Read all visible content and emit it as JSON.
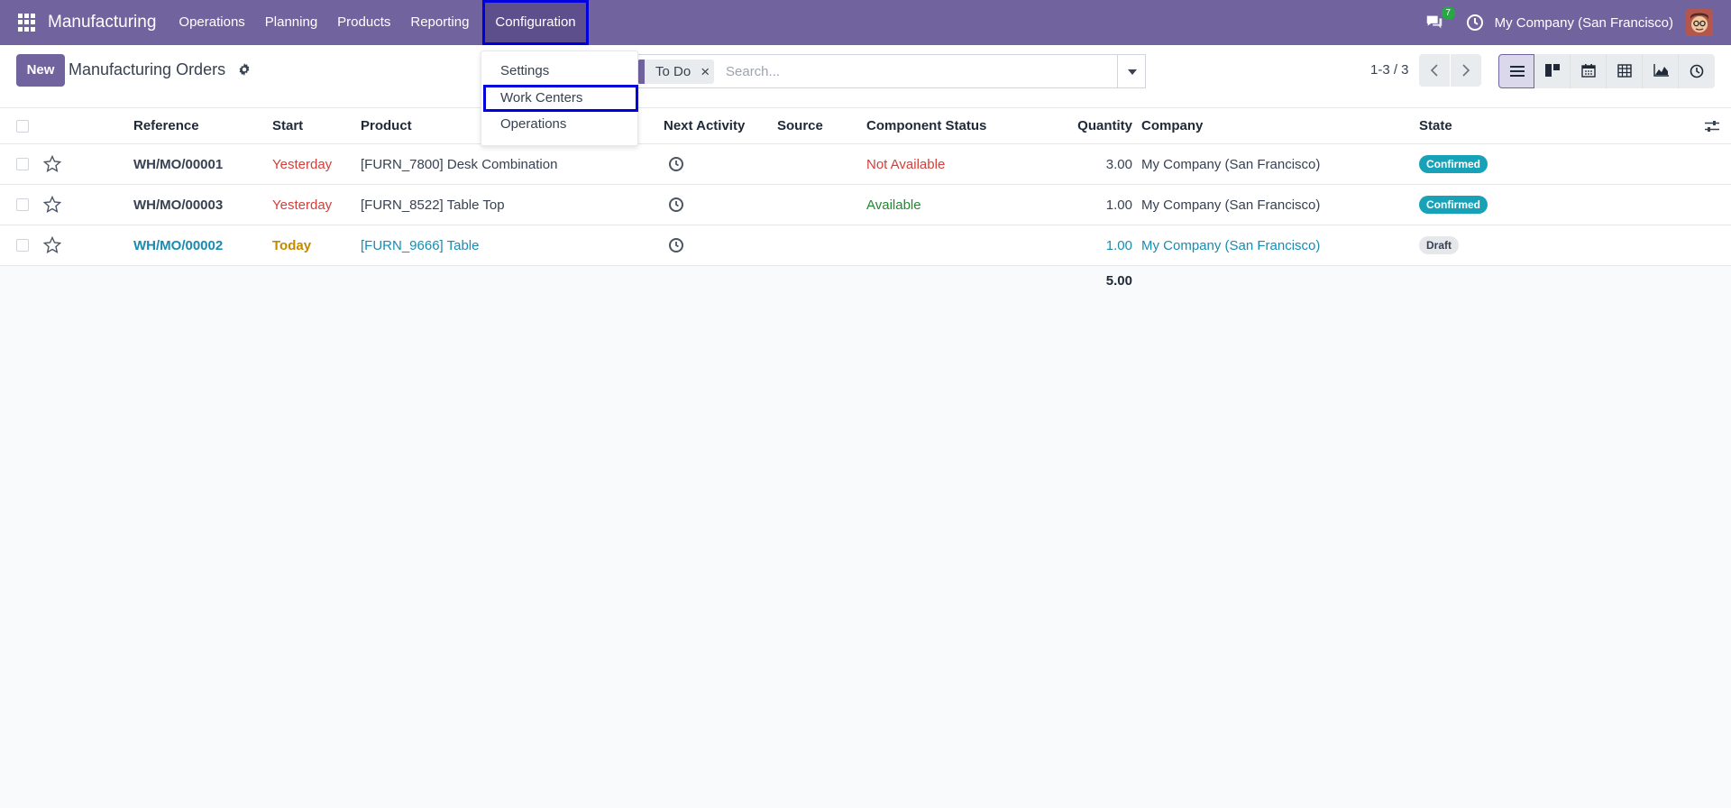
{
  "navbar": {
    "brand": "Manufacturing",
    "menu": [
      "Operations",
      "Planning",
      "Products",
      "Reporting",
      "Configuration"
    ],
    "chat_count": "7",
    "company": "My Company (San Francisco)"
  },
  "control": {
    "new_label": "New",
    "title": "Manufacturing Orders",
    "facet": "To Do",
    "search_placeholder": "Search...",
    "pager": "1-3 / 3"
  },
  "dropdown": {
    "items": [
      "Settings",
      "Work Centers",
      "Operations"
    ]
  },
  "table": {
    "headers": [
      "Reference",
      "Start",
      "Product",
      "Next Activity",
      "Source",
      "Component Status",
      "Quantity",
      "Company",
      "State"
    ],
    "rows": [
      {
        "reference": "WH/MO/00001",
        "start": "Yesterday",
        "product": "[FURN_7800] Desk Combination",
        "source": "",
        "component_status": "Not Available",
        "quantity": "3.00",
        "company": "My Company (San Francisco)",
        "state": "Confirmed"
      },
      {
        "reference": "WH/MO/00003",
        "start": "Yesterday",
        "product": "[FURN_8522] Table Top",
        "source": "",
        "component_status": "Available",
        "quantity": "1.00",
        "company": "My Company (San Francisco)",
        "state": "Confirmed"
      },
      {
        "reference": "WH/MO/00002",
        "start": "Today",
        "product": "[FURN_9666] Table",
        "source": "",
        "component_status": "",
        "quantity": "1.00",
        "company": "My Company (San Francisco)",
        "state": "Draft"
      }
    ],
    "total_quantity": "5.00"
  },
  "colors": {
    "brand": "#71639e",
    "highlight_outline": "#0000dd",
    "confirmed": "#17a2b8",
    "danger": "#d23f3a",
    "success": "#208a30",
    "warning": "#c28a00",
    "link": "#1a8bb0"
  },
  "icons": [
    "apps-grid-icon",
    "chat-icon",
    "clock-icon",
    "gear-icon",
    "star-icon",
    "activity-clock-icon",
    "column-settings-icon",
    "chevron-left-icon",
    "chevron-right-icon",
    "list-view-icon",
    "kanban-view-icon",
    "calendar-view-icon",
    "pivot-view-icon",
    "graph-view-icon",
    "activity-view-icon"
  ]
}
